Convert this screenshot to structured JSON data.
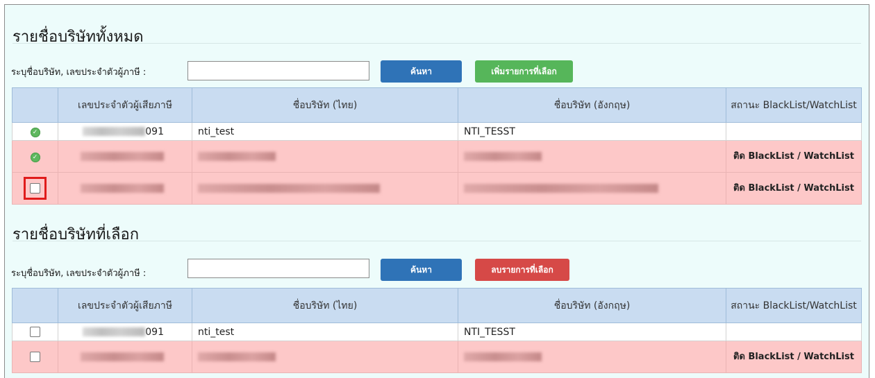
{
  "sections": [
    {
      "title": "รายชื่อบริษัททั้งหมด",
      "search_label": "ระบุชื่อบริษัท, เลขประจำตัวผู้ภาษี :",
      "search_value": "",
      "search_button": "ค้นหา",
      "action_button": "เพิ่มรายการที่เลือก",
      "columns": [
        "",
        "เลขประจำตัวผู้เสียภาษี",
        "ชื่อบริษัท (ไทย)",
        "ชื่อบริษัท (อังกฤษ)",
        "สถานะ BlackList/WatchList"
      ],
      "rows": [
        {
          "select": "selected",
          "tax_id": "091",
          "name_th": "nti_test",
          "name_en": "NTI_TESST",
          "status": ""
        },
        {
          "select": "selected",
          "tax_id": "",
          "name_th": "",
          "name_en": "",
          "status": "ติด BlackList / WatchList"
        },
        {
          "select": "checkbox",
          "tax_id": "",
          "name_th": "",
          "name_en": "",
          "status": "ติด BlackList / WatchList"
        }
      ]
    },
    {
      "title": "รายชื่อบริษัทที่เลือก",
      "search_label": "ระบุชื่อบริษัท, เลขประจำตัวผู้ภาษี :",
      "search_value": "",
      "search_button": "ค้นหา",
      "action_button": "ลบรายการที่เลือก",
      "columns": [
        "",
        "เลขประจำตัวผู้เสียภาษี",
        "ชื่อบริษัท (ไทย)",
        "ชื่อบริษัท (อังกฤษ)",
        "สถานะ BlackList/WatchList"
      ],
      "rows": [
        {
          "select": "checkbox",
          "tax_id": "091",
          "name_th": "nti_test",
          "name_en": "NTI_TESST",
          "status": ""
        },
        {
          "select": "checkbox",
          "tax_id": "",
          "name_th": "",
          "name_en": "",
          "status": "ติด BlackList / WatchList"
        }
      ]
    }
  ],
  "colors": {
    "panel_bg": "#edfcfb",
    "header_bg": "#c9dcf1",
    "flag_row_bg": "#fdc8c8",
    "search_button": "#2f73b7",
    "add_button": "#56b65a",
    "remove_button": "#d64947",
    "highlight_border": "#e01b1b"
  }
}
